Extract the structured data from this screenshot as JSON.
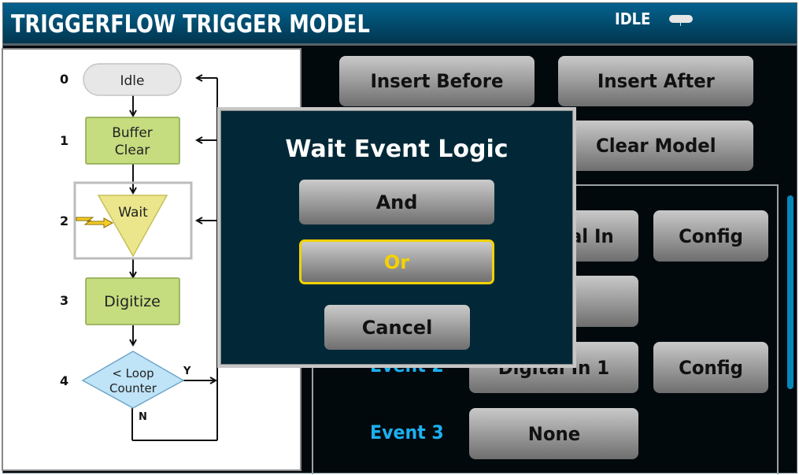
{
  "header": {
    "title": "TRIGGERFLOW TRIGGER MODEL",
    "status": "IDLE",
    "status_icon": "idle-indicator-icon"
  },
  "flowchart": {
    "steps": [
      {
        "index": "0",
        "label": "Idle",
        "shape": "terminal"
      },
      {
        "index": "1",
        "label_lines": [
          "Buffer",
          "Clear"
        ],
        "shape": "process"
      },
      {
        "index": "2",
        "label": "Wait",
        "shape": "wait-triangle",
        "selected": true
      },
      {
        "index": "3",
        "label": "Digitize",
        "shape": "process"
      },
      {
        "index": "4",
        "label_lines": [
          "< Loop",
          "Counter"
        ],
        "shape": "decision",
        "yes": "Y",
        "no": "N"
      }
    ]
  },
  "toolbar": {
    "insert_before": "Insert Before",
    "insert_after": "Insert After",
    "clear_model": "Clear Model"
  },
  "events": {
    "row1": {
      "source": "Digital In",
      "config": "Config"
    },
    "row2_source": "",
    "event2": {
      "label": "Event 2",
      "source": "Digital In 1",
      "config": "Config"
    },
    "event3": {
      "label": "Event 3",
      "source": "None"
    }
  },
  "dialog": {
    "title": "Wait Event Logic",
    "options": [
      "And",
      "Or"
    ],
    "selected": "Or",
    "cancel": "Cancel"
  },
  "colors": {
    "header_top": "#03628e",
    "accent_blue": "#1cb0f0",
    "selected_yellow": "#f3d200",
    "process_green": "#c5dc7f",
    "wait_yellow": "#ebe68c",
    "decision_blue": "#bfe3f7",
    "dialog_bg": "#022838"
  }
}
